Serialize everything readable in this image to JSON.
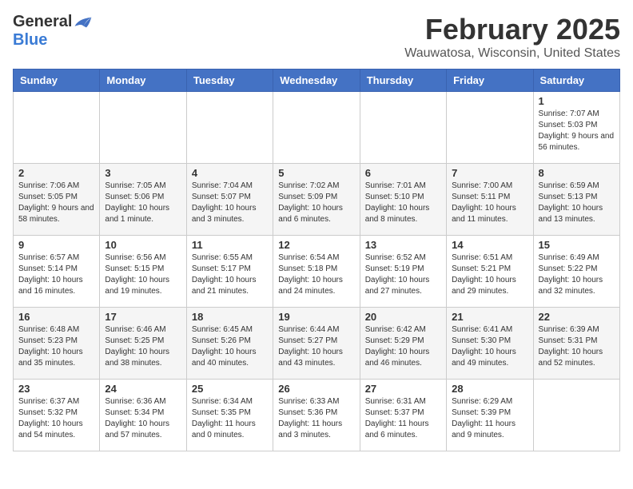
{
  "logo": {
    "general": "General",
    "blue": "Blue"
  },
  "title": "February 2025",
  "location": "Wauwatosa, Wisconsin, United States",
  "days_of_week": [
    "Sunday",
    "Monday",
    "Tuesday",
    "Wednesday",
    "Thursday",
    "Friday",
    "Saturday"
  ],
  "weeks": [
    [
      {
        "day": "",
        "sunrise": "",
        "sunset": "",
        "daylight": ""
      },
      {
        "day": "",
        "sunrise": "",
        "sunset": "",
        "daylight": ""
      },
      {
        "day": "",
        "sunrise": "",
        "sunset": "",
        "daylight": ""
      },
      {
        "day": "",
        "sunrise": "",
        "sunset": "",
        "daylight": ""
      },
      {
        "day": "",
        "sunrise": "",
        "sunset": "",
        "daylight": ""
      },
      {
        "day": "",
        "sunrise": "",
        "sunset": "",
        "daylight": ""
      },
      {
        "day": "1",
        "sunrise": "Sunrise: 7:07 AM",
        "sunset": "Sunset: 5:03 PM",
        "daylight": "Daylight: 9 hours and 56 minutes."
      }
    ],
    [
      {
        "day": "2",
        "sunrise": "Sunrise: 7:06 AM",
        "sunset": "Sunset: 5:05 PM",
        "daylight": "Daylight: 9 hours and 58 minutes."
      },
      {
        "day": "3",
        "sunrise": "Sunrise: 7:05 AM",
        "sunset": "Sunset: 5:06 PM",
        "daylight": "Daylight: 10 hours and 1 minute."
      },
      {
        "day": "4",
        "sunrise": "Sunrise: 7:04 AM",
        "sunset": "Sunset: 5:07 PM",
        "daylight": "Daylight: 10 hours and 3 minutes."
      },
      {
        "day": "5",
        "sunrise": "Sunrise: 7:02 AM",
        "sunset": "Sunset: 5:09 PM",
        "daylight": "Daylight: 10 hours and 6 minutes."
      },
      {
        "day": "6",
        "sunrise": "Sunrise: 7:01 AM",
        "sunset": "Sunset: 5:10 PM",
        "daylight": "Daylight: 10 hours and 8 minutes."
      },
      {
        "day": "7",
        "sunrise": "Sunrise: 7:00 AM",
        "sunset": "Sunset: 5:11 PM",
        "daylight": "Daylight: 10 hours and 11 minutes."
      },
      {
        "day": "8",
        "sunrise": "Sunrise: 6:59 AM",
        "sunset": "Sunset: 5:13 PM",
        "daylight": "Daylight: 10 hours and 13 minutes."
      }
    ],
    [
      {
        "day": "9",
        "sunrise": "Sunrise: 6:57 AM",
        "sunset": "Sunset: 5:14 PM",
        "daylight": "Daylight: 10 hours and 16 minutes."
      },
      {
        "day": "10",
        "sunrise": "Sunrise: 6:56 AM",
        "sunset": "Sunset: 5:15 PM",
        "daylight": "Daylight: 10 hours and 19 minutes."
      },
      {
        "day": "11",
        "sunrise": "Sunrise: 6:55 AM",
        "sunset": "Sunset: 5:17 PM",
        "daylight": "Daylight: 10 hours and 21 minutes."
      },
      {
        "day": "12",
        "sunrise": "Sunrise: 6:54 AM",
        "sunset": "Sunset: 5:18 PM",
        "daylight": "Daylight: 10 hours and 24 minutes."
      },
      {
        "day": "13",
        "sunrise": "Sunrise: 6:52 AM",
        "sunset": "Sunset: 5:19 PM",
        "daylight": "Daylight: 10 hours and 27 minutes."
      },
      {
        "day": "14",
        "sunrise": "Sunrise: 6:51 AM",
        "sunset": "Sunset: 5:21 PM",
        "daylight": "Daylight: 10 hours and 29 minutes."
      },
      {
        "day": "15",
        "sunrise": "Sunrise: 6:49 AM",
        "sunset": "Sunset: 5:22 PM",
        "daylight": "Daylight: 10 hours and 32 minutes."
      }
    ],
    [
      {
        "day": "16",
        "sunrise": "Sunrise: 6:48 AM",
        "sunset": "Sunset: 5:23 PM",
        "daylight": "Daylight: 10 hours and 35 minutes."
      },
      {
        "day": "17",
        "sunrise": "Sunrise: 6:46 AM",
        "sunset": "Sunset: 5:25 PM",
        "daylight": "Daylight: 10 hours and 38 minutes."
      },
      {
        "day": "18",
        "sunrise": "Sunrise: 6:45 AM",
        "sunset": "Sunset: 5:26 PM",
        "daylight": "Daylight: 10 hours and 40 minutes."
      },
      {
        "day": "19",
        "sunrise": "Sunrise: 6:44 AM",
        "sunset": "Sunset: 5:27 PM",
        "daylight": "Daylight: 10 hours and 43 minutes."
      },
      {
        "day": "20",
        "sunrise": "Sunrise: 6:42 AM",
        "sunset": "Sunset: 5:29 PM",
        "daylight": "Daylight: 10 hours and 46 minutes."
      },
      {
        "day": "21",
        "sunrise": "Sunrise: 6:41 AM",
        "sunset": "Sunset: 5:30 PM",
        "daylight": "Daylight: 10 hours and 49 minutes."
      },
      {
        "day": "22",
        "sunrise": "Sunrise: 6:39 AM",
        "sunset": "Sunset: 5:31 PM",
        "daylight": "Daylight: 10 hours and 52 minutes."
      }
    ],
    [
      {
        "day": "23",
        "sunrise": "Sunrise: 6:37 AM",
        "sunset": "Sunset: 5:32 PM",
        "daylight": "Daylight: 10 hours and 54 minutes."
      },
      {
        "day": "24",
        "sunrise": "Sunrise: 6:36 AM",
        "sunset": "Sunset: 5:34 PM",
        "daylight": "Daylight: 10 hours and 57 minutes."
      },
      {
        "day": "25",
        "sunrise": "Sunrise: 6:34 AM",
        "sunset": "Sunset: 5:35 PM",
        "daylight": "Daylight: 11 hours and 0 minutes."
      },
      {
        "day": "26",
        "sunrise": "Sunrise: 6:33 AM",
        "sunset": "Sunset: 5:36 PM",
        "daylight": "Daylight: 11 hours and 3 minutes."
      },
      {
        "day": "27",
        "sunrise": "Sunrise: 6:31 AM",
        "sunset": "Sunset: 5:37 PM",
        "daylight": "Daylight: 11 hours and 6 minutes."
      },
      {
        "day": "28",
        "sunrise": "Sunrise: 6:29 AM",
        "sunset": "Sunset: 5:39 PM",
        "daylight": "Daylight: 11 hours and 9 minutes."
      },
      {
        "day": "",
        "sunrise": "",
        "sunset": "",
        "daylight": ""
      }
    ]
  ]
}
